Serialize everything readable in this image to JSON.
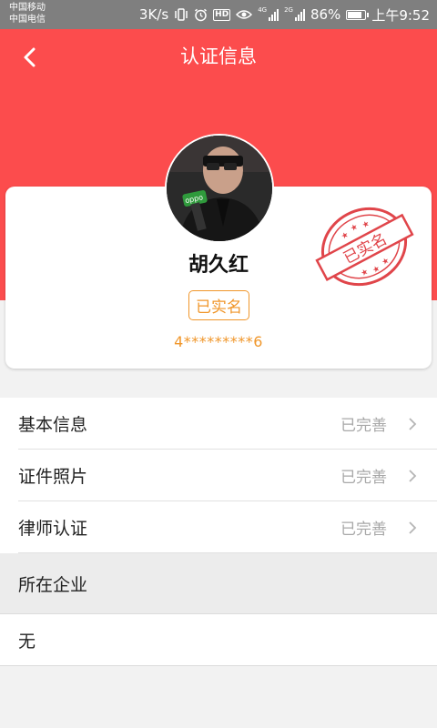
{
  "status_bar": {
    "carrier_1": "中国移动",
    "carrier_2": "中国电信",
    "speed": "3K/s",
    "hd": "HD",
    "net_1": "4G",
    "net_2": "2G",
    "battery": "86%",
    "battery_level": 0.86,
    "time": "上午9:52",
    "icons": [
      "vibrate-icon",
      "alarm-icon",
      "hd-icon",
      "eye-icon",
      "signal-icon",
      "battery-icon"
    ]
  },
  "header": {
    "title": "认证信息",
    "back_icon": "chevron-left-icon"
  },
  "profile": {
    "name": "胡久红",
    "badge": "已实名",
    "id_number": "4*********6",
    "stamp_text": "已实名"
  },
  "info_rows": [
    {
      "label": "基本信息",
      "value": "已完善"
    },
    {
      "label": "证件照片",
      "value": "已完善"
    },
    {
      "label": "律师认证",
      "value": "已完善"
    }
  ],
  "company": {
    "section_title": "所在企业",
    "value": "无"
  },
  "colors": {
    "header": "#fc4c4d",
    "accent_orange": "#f0962a",
    "stamp_red": "#e0454a"
  }
}
